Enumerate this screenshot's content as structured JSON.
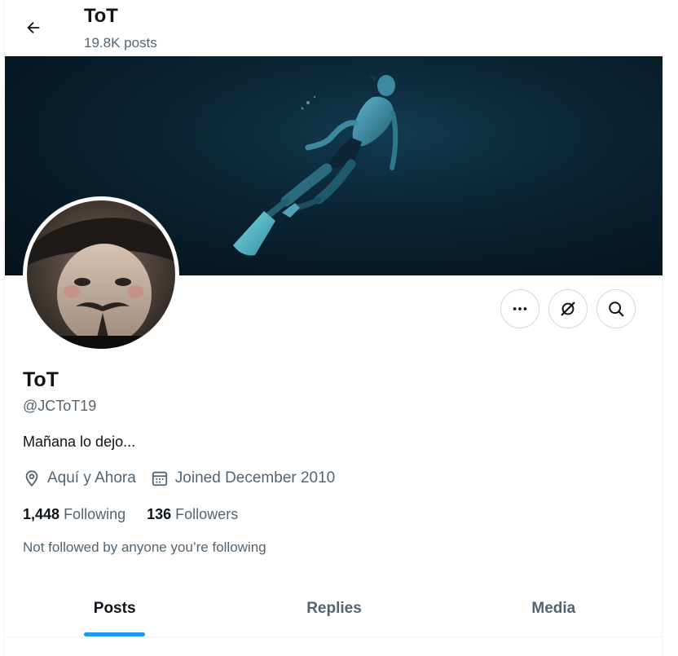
{
  "header": {
    "title": "ToT",
    "posts_count": "19.8K posts"
  },
  "profile": {
    "name": "ToT",
    "handle": "@JCToT19",
    "bio": "Mañana lo dejo...",
    "location": "Aquí y Ahora",
    "joined": "Joined December 2010",
    "following_count": "1,448",
    "following_label": "Following",
    "followers_count": "136",
    "followers_label": "Followers",
    "not_followed_note": "Not followed by anyone you’re following"
  },
  "actions": [
    {
      "name": "more-button",
      "icon": "more-dots-icon"
    },
    {
      "name": "grok-button",
      "icon": "grok-slash-icon"
    },
    {
      "name": "search-button",
      "icon": "search-icon"
    }
  ],
  "tabs": [
    {
      "label": "Posts",
      "active": true
    },
    {
      "label": "Replies",
      "active": false
    },
    {
      "label": "Media",
      "active": false
    }
  ],
  "colors": {
    "accent": "#1d9bf0",
    "text_primary": "#0f1419",
    "text_secondary": "#536471"
  }
}
